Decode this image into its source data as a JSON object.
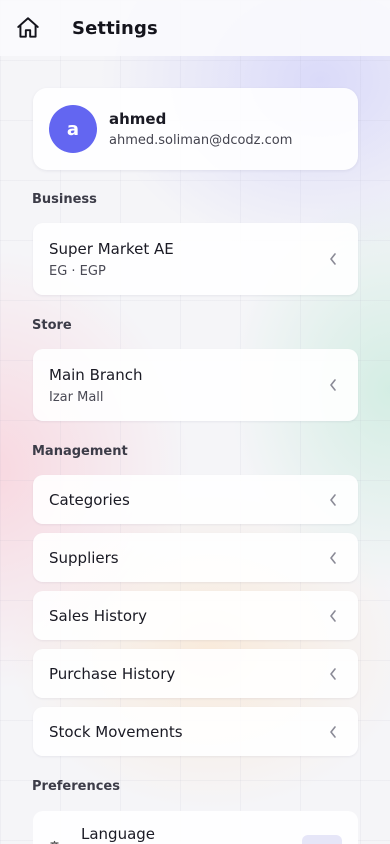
{
  "header": {
    "title": "Settings",
    "home_icon": "home-icon"
  },
  "profile": {
    "initial": "a",
    "name": "ahmed",
    "email": "ahmed.soliman@dcodz.com",
    "avatar_color": "#6366f1"
  },
  "sections": {
    "business": {
      "label": "Business",
      "item": {
        "title": "Super Market AE",
        "subtitle": "EG · EGP"
      }
    },
    "store": {
      "label": "Store",
      "item": {
        "title": "Main Branch",
        "subtitle": "Izar Mall"
      }
    },
    "management": {
      "label": "Management",
      "items": [
        {
          "label": "Categories"
        },
        {
          "label": "Suppliers"
        },
        {
          "label": "Sales History"
        },
        {
          "label": "Purchase History"
        },
        {
          "label": "Stock Movements"
        }
      ]
    },
    "preferences": {
      "label": "Preferences",
      "language": {
        "label": "Language",
        "icon": "translate-icon"
      }
    }
  }
}
